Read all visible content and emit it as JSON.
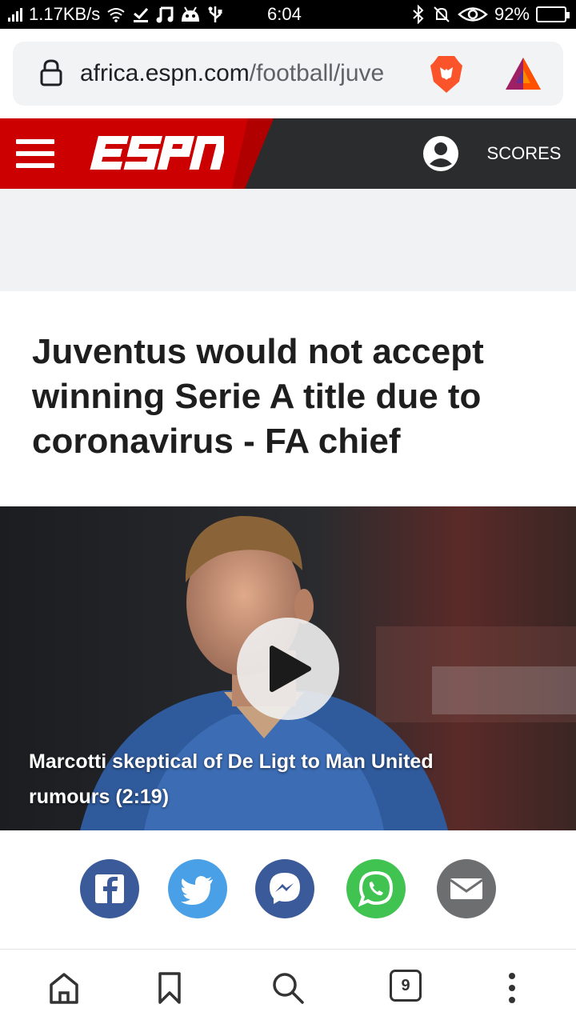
{
  "status_bar": {
    "network_speed": "1.17KB/s",
    "time": "6:04",
    "battery_percent": "92%"
  },
  "browser": {
    "url_host": "africa.espn.com",
    "url_path": "/football/juve"
  },
  "site_header": {
    "logo_text": "ESPN",
    "scores_label": "SCORES",
    "brand_color": "#cc0000"
  },
  "article": {
    "headline": "Juventus would not accept winning Serie A title due to coronavirus - FA chief"
  },
  "video": {
    "caption": "Marcotti skeptical of De Ligt to Man United rumours (2:19)"
  },
  "share_buttons": [
    {
      "name": "facebook",
      "color": "#3b5a9a",
      "icon": "facebook-icon"
    },
    {
      "name": "twitter",
      "color": "#4aa0e6",
      "icon": "twitter-icon"
    },
    {
      "name": "messenger",
      "color": "#3b5a9a",
      "icon": "messenger-icon"
    },
    {
      "name": "whatsapp",
      "color": "#40c351",
      "icon": "whatsapp-icon"
    },
    {
      "name": "email",
      "color": "#6d6e6f",
      "icon": "email-icon"
    }
  ],
  "bottom_nav": {
    "tab_count": "9",
    "items": [
      "home-icon",
      "bookmark-icon",
      "search-icon",
      "tabs-icon",
      "more-icon"
    ]
  }
}
